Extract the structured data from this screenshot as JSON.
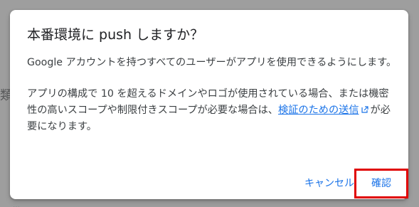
{
  "background": {
    "glyph_left": "類",
    "glyph_bottom": "…"
  },
  "dialog": {
    "title": "本番環境に push しますか？",
    "paragraph1": "Google アカウントを持つすべてのユーザーがアプリを使用できるようにします。",
    "paragraph2_prefix": "アプリの構成で 10 を超えるドメインやロゴが使用されている場合、または機密性の高いスコープや制限付きスコープが必要な場合は、",
    "paragraph2_link": "検証のための送信",
    "paragraph2_suffix": "が必要になります。",
    "link_icon": "external-link-icon",
    "cancel_label": "キャンセル",
    "confirm_label": "確認"
  },
  "colors": {
    "accent": "#1a73e8",
    "highlight_box": "#e00000",
    "overlay": "#9e9e9e"
  }
}
